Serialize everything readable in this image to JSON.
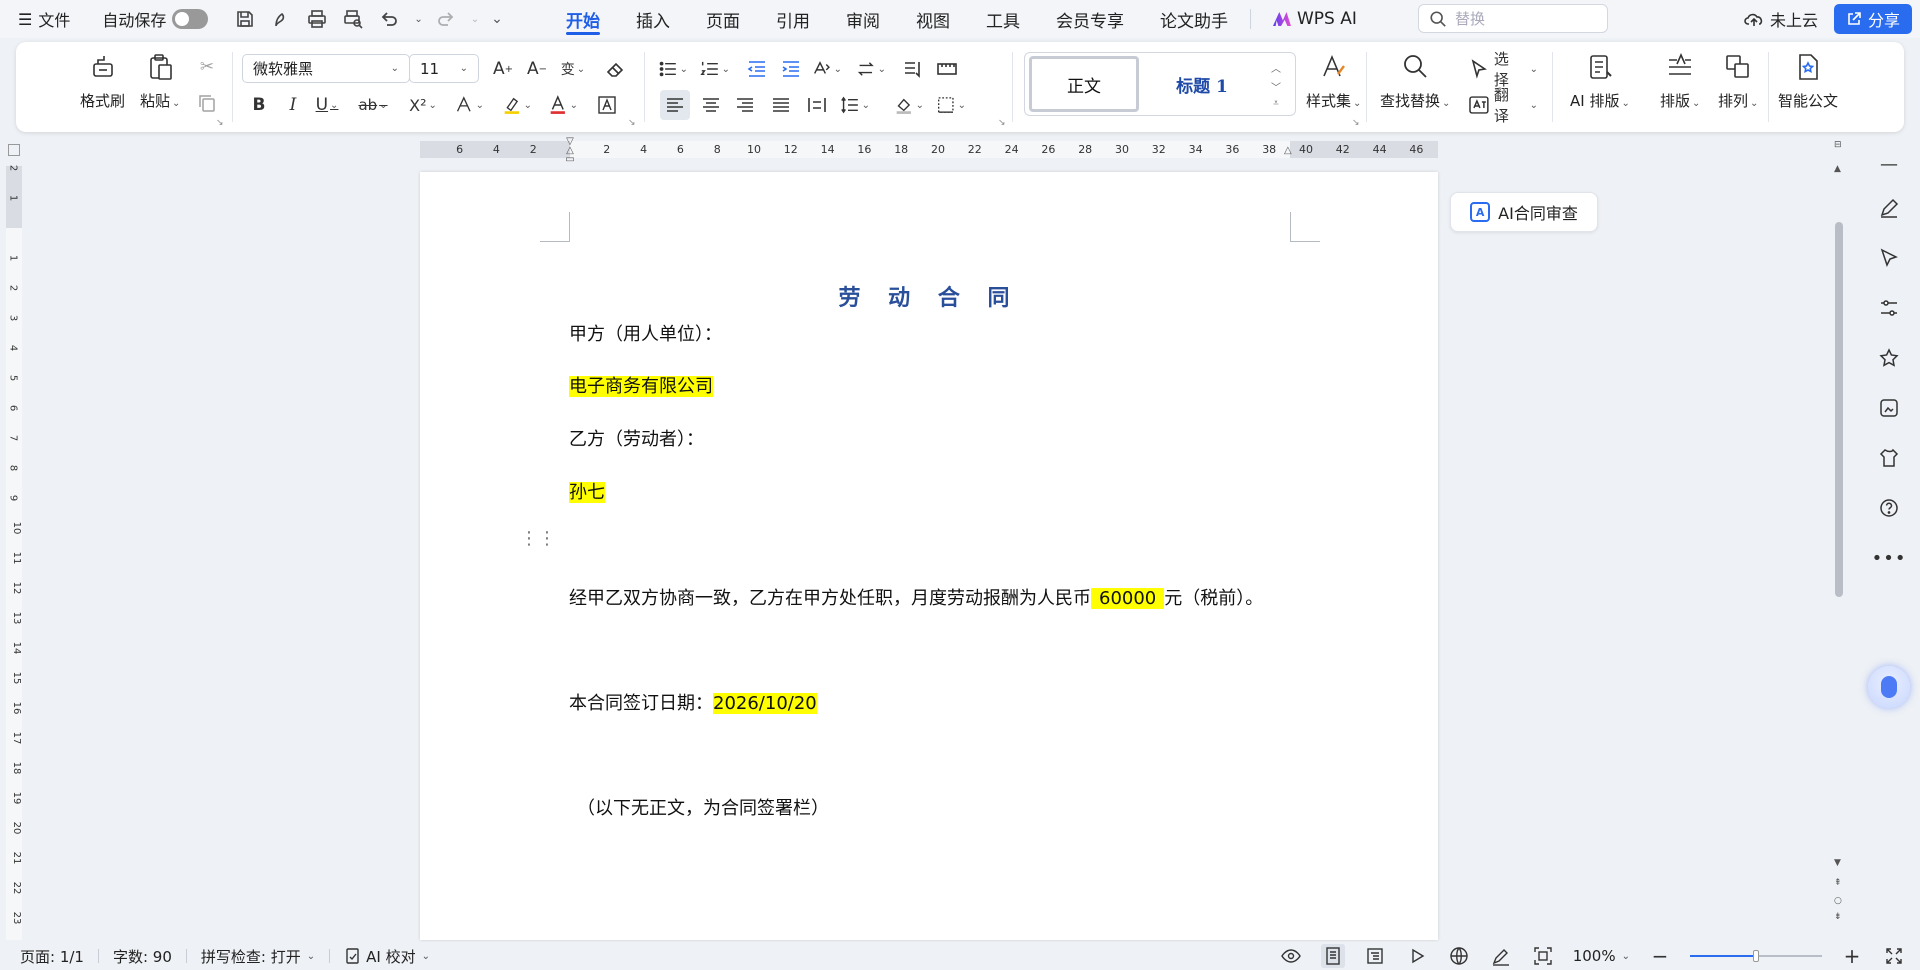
{
  "menubar": {
    "file_label": "文件",
    "autosave_label": "自动保存",
    "tabs": [
      "开始",
      "插入",
      "页面",
      "引用",
      "审阅",
      "视图",
      "工具",
      "会员专享",
      "论文助手"
    ],
    "active_tab": "开始",
    "wps_ai_label": "WPS AI",
    "search_placeholder": "替换",
    "cloud_label": "未上云",
    "share_label": "分享"
  },
  "ribbon": {
    "format_painter": "格式刷",
    "paste": "粘贴",
    "font_name": "微软雅黑",
    "font_size": "11",
    "style_normal": "正文",
    "style_heading1": "标题 1",
    "style_set": "样式集",
    "find_replace": "查找替换",
    "select": "选择",
    "translate": "翻译",
    "ai_layout": "AI 排版",
    "layout": "排版",
    "arrange": "排列",
    "smart_doc": "智能公文",
    "bold": "B",
    "italic": "I",
    "underline": "U",
    "strike": "ab",
    "superscript": "X²",
    "text_a": "A"
  },
  "ruler": {
    "h_left": [
      "6",
      "4",
      "2"
    ],
    "h_right": [
      "2",
      "4",
      "6",
      "8",
      "10",
      "12",
      "14",
      "16",
      "18",
      "20",
      "22",
      "24",
      "26",
      "28",
      "30",
      "32",
      "34",
      "36",
      "38",
      "40",
      "42",
      "44",
      "46"
    ],
    "v_top": [
      "2",
      "1"
    ],
    "v_main": [
      "1",
      "2",
      "3",
      "4",
      "5",
      "6",
      "7",
      "8",
      "9",
      "10",
      "11",
      "12",
      "13",
      "14",
      "15",
      "16",
      "17",
      "18",
      "19",
      "20",
      "21",
      "22",
      "23"
    ]
  },
  "document": {
    "title": "劳 动 合 同",
    "party_a_label": "甲方（用人单位）：",
    "party_a_name": "电子商务有限公司",
    "party_b_label": "乙方（劳动者）：",
    "party_b_name": "孙七",
    "salary_prefix": "经甲乙双方协商一致，乙方在甲方处任职，月度劳动报酬为人民币",
    "salary_amount": "60000",
    "salary_suffix": "元（税前）。",
    "sign_date_label": "本合同签订日期：",
    "sign_date": "2026/10/20",
    "ending_note": "（以下无正文，为合同签署栏）"
  },
  "ai_review_label": "AI合同审查",
  "statusbar": {
    "page": "页面: 1/1",
    "word_count": "字数: 90",
    "spell_check": "拼写检查: 打开",
    "ai_proofread": "AI 校对",
    "zoom": "100%"
  },
  "colors": {
    "accent": "#1f5ee6",
    "highlight": "#ffff00",
    "title_blue": "#2a4f9a",
    "share_bg": "#2a6cf0"
  }
}
